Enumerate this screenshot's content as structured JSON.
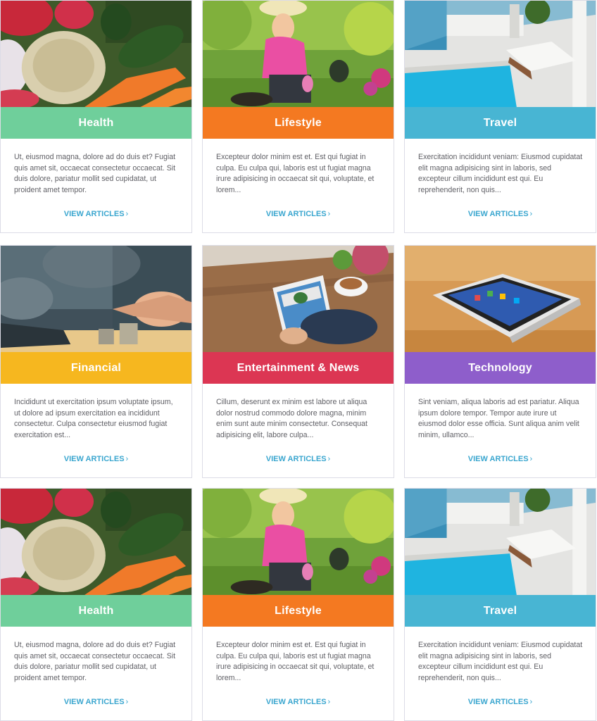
{
  "cards": [
    {
      "title": "Health",
      "desc": "Ut, eiusmod magna, dolore ad do duis et? Fugiat quis amet sit, occaecat consectetur occaecat. Sit duis dolore, pariatur mollit sed cupidatat, ut proident amet tempor.",
      "cta": "VIEW ARTICLES",
      "color": "#6fcf9b",
      "image": "vegetables"
    },
    {
      "title": "Lifestyle",
      "desc": "Excepteur dolor minim est et. Est qui fugiat in culpa. Eu culpa qui, laboris est ut fugiat magna irure adipisicing in occaecat sit qui, voluptate, et lorem...",
      "cta": "VIEW ARTICLES",
      "color": "#f47921",
      "image": "gardening"
    },
    {
      "title": "Travel",
      "desc": "Exercitation incididunt veniam: Eiusmod cupidatat elit magna adipisicing sint in laboris, sed excepteur cillum incididunt est qui. Eu reprehenderit, non quis...",
      "cta": "VIEW ARTICLES",
      "color": "#48b5d3",
      "image": "pool"
    },
    {
      "title": "Financial",
      "desc": "Incididunt ut exercitation ipsum voluptate ipsum, ut dolore ad ipsum exercitation ea incididunt consectetur. Culpa consectetur eiusmod fugiat exercitation est...",
      "cta": "VIEW ARTICLES",
      "color": "#f6b71f",
      "image": "coins"
    },
    {
      "title": "Entertainment & News",
      "desc": "Cillum, deserunt ex minim est labore ut aliqua dolor nostrud commodo dolore magna, minim enim sunt aute minim consectetur. Consequat adipisicing elit, labore culpa...",
      "cta": "VIEW ARTICLES",
      "color": "#dc3653",
      "image": "tablet"
    },
    {
      "title": "Technology",
      "desc": "Sint veniam, aliqua laboris ad est pariatur. Aliqua ipsum dolore tempor. Tempor aute irure ut eiusmod dolor esse officia. Sunt aliqua anim velit minim, ullamco...",
      "cta": "VIEW ARTICLES",
      "color": "#8e5ecb",
      "image": "smartphone"
    },
    {
      "title": "Health",
      "desc": "Ut, eiusmod magna, dolore ad do duis et? Fugiat quis amet sit, occaecat consectetur occaecat. Sit duis dolore, pariatur mollit sed cupidatat, ut proident amet tempor.",
      "cta": "VIEW ARTICLES",
      "color": "#6fcf9b",
      "image": "vegetables"
    },
    {
      "title": "Lifestyle",
      "desc": "Excepteur dolor minim est et. Est qui fugiat in culpa. Eu culpa qui, laboris est ut fugiat magna irure adipisicing in occaecat sit qui, voluptate, et lorem...",
      "cta": "VIEW ARTICLES",
      "color": "#f47921",
      "image": "gardening"
    },
    {
      "title": "Travel",
      "desc": "Exercitation incididunt veniam: Eiusmod cupidatat elit magna adipisicing sint in laboris, sed excepteur cillum incididunt est qui. Eu reprehenderit, non quis...",
      "cta": "VIEW ARTICLES",
      "color": "#48b5d3",
      "image": "pool"
    }
  ]
}
